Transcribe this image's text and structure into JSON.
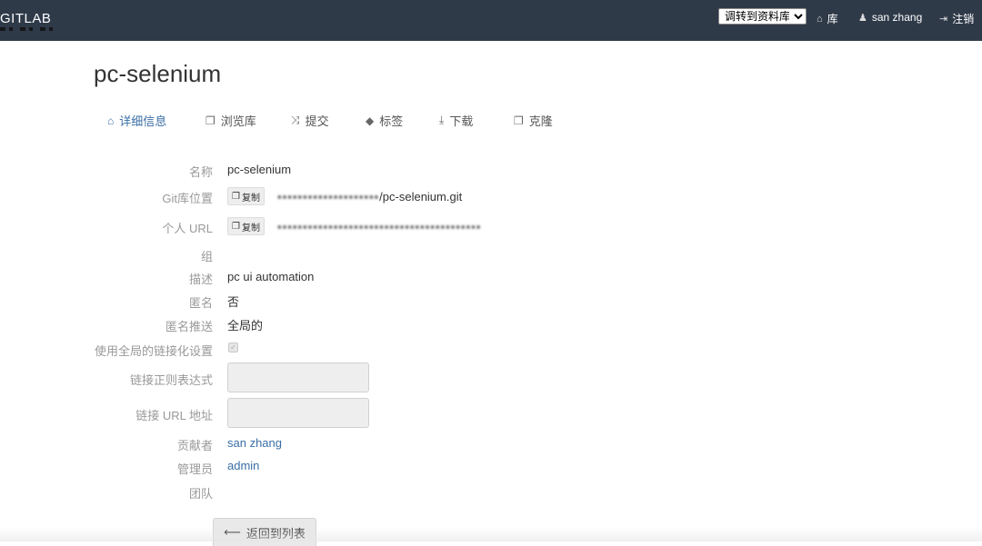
{
  "navbar": {
    "brand": "GITLAB",
    "jump_select": {
      "selected": "调转到资料库"
    },
    "repo_link": "库",
    "user_link": "san zhang",
    "logout_link": "注销"
  },
  "page": {
    "title": "pc-selenium"
  },
  "tabs": [
    {
      "label": "详细信息",
      "icon": "inbox-icon",
      "active": true
    },
    {
      "label": "浏览库",
      "icon": "copy-icon"
    },
    {
      "label": "提交",
      "icon": "shuffle-icon"
    },
    {
      "label": "标签",
      "icon": "tag-icon"
    },
    {
      "label": "下载",
      "icon": "download-icon"
    },
    {
      "label": "克隆",
      "icon": "copy-icon"
    }
  ],
  "fields": {
    "name": {
      "label": "名称",
      "value": "pc-selenium"
    },
    "git_url": {
      "label": "Git库位置",
      "copy": "复制",
      "value": "/pc-selenium.git"
    },
    "personal_url": {
      "label": "个人 URL",
      "copy": "复制"
    },
    "group": {
      "label": "组"
    },
    "description": {
      "label": "描述",
      "value": "pc ui automation"
    },
    "anonymous": {
      "label": "匿名",
      "value": "否"
    },
    "anonymous_push": {
      "label": "匿名推送",
      "value": "全局的"
    },
    "use_global_link": {
      "label": "使用全局的链接化设置",
      "checked": true
    },
    "link_regex": {
      "label": "链接正则表达式",
      "value": ""
    },
    "link_url": {
      "label": "链接 URL 地址",
      "value": ""
    },
    "contributors": {
      "label": "贡献者",
      "value": "san zhang"
    },
    "admins": {
      "label": "管理员",
      "value": "admin"
    },
    "team": {
      "label": "团队"
    }
  },
  "back_button": "返回到列表"
}
